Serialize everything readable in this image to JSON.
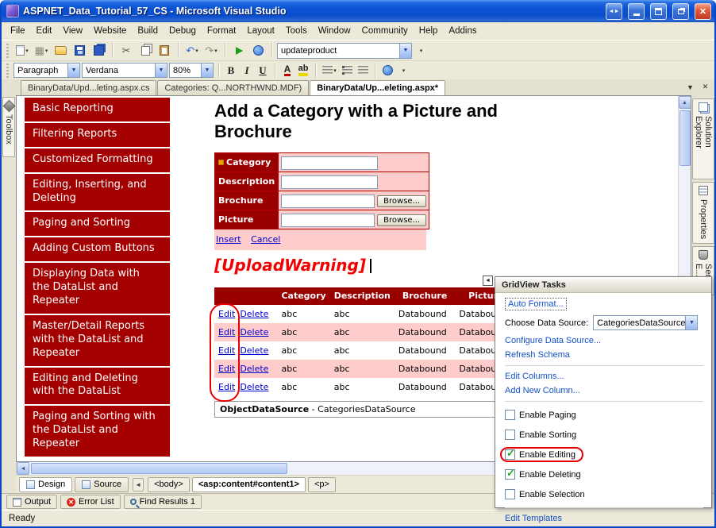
{
  "window": {
    "title": "ASPNET_Data_Tutorial_57_CS - Microsoft Visual Studio",
    "status": "Ready"
  },
  "menu": [
    "File",
    "Edit",
    "View",
    "Website",
    "Build",
    "Debug",
    "Format",
    "Layout",
    "Tools",
    "Window",
    "Community",
    "Help",
    "Addins"
  ],
  "standard_toolbar": {
    "combo_value": "updateproduct"
  },
  "format_toolbar": {
    "block_format": "Paragraph",
    "font_name": "Verdana",
    "font_size": "80%",
    "bold": "B",
    "italic": "I",
    "underline": "U"
  },
  "document_tabs": [
    "BinaryData/Upd...leting.aspx.cs",
    "Categories: Q...NORTHWND.MDF)",
    "BinaryData/Up...eleting.aspx*"
  ],
  "toolbox_tab": "Toolbox",
  "tutorial_nav": [
    "Basic Reporting",
    "Filtering Reports",
    "Customized Formatting",
    "Editing, Inserting, and Deleting",
    "Paging and Sorting",
    "Adding Custom Buttons",
    "Displaying Data with the DataList and Repeater",
    "Master/Detail Reports with the DataList and Repeater",
    "Editing and Deleting with the DataList",
    "Paging and Sorting with the DataList and Repeater"
  ],
  "page": {
    "heading": "Add a Category with a Picture and Brochure",
    "form_labels": [
      "Category",
      "Description",
      "Brochure",
      "Picture"
    ],
    "browse_button": "Browse...",
    "insert_link": "Insert",
    "cancel_link": "Cancel",
    "upload_warning": "[UploadWarning]",
    "grid": {
      "headers": [
        "Category",
        "Description",
        "Brochure",
        "Picture"
      ],
      "rows": [
        [
          "Edit",
          "Delete",
          "abc",
          "abc",
          "Databound",
          "Databound"
        ],
        [
          "Edit",
          "Delete",
          "abc",
          "abc",
          "Databound",
          "Databound"
        ],
        [
          "Edit",
          "Delete",
          "abc",
          "abc",
          "Databound",
          "Databound"
        ],
        [
          "Edit",
          "Delete",
          "abc",
          "abc",
          "Databound",
          "Databound"
        ],
        [
          "Edit",
          "Delete",
          "abc",
          "abc",
          "Databound",
          "Databound"
        ]
      ]
    },
    "datasource_bold": "ObjectDataSource",
    "datasource_rest": " - CategoriesDataSource"
  },
  "tasks_panel": {
    "title": "GridView Tasks",
    "auto_format": "Auto Format...",
    "choose_data_source_label": "Choose Data Source:",
    "choose_data_source_value": "CategoriesDataSource",
    "configure": "Configure Data Source...",
    "refresh": "Refresh Schema",
    "edit_columns": "Edit Columns...",
    "add_column": "Add New Column...",
    "checkboxes": [
      {
        "label": "Enable Paging",
        "mark": ""
      },
      {
        "label": "Enable Sorting",
        "mark": ""
      },
      {
        "label": "Enable Editing",
        "mark": "✓"
      },
      {
        "label": "Enable Deleting",
        "mark": "✓"
      },
      {
        "label": "Enable Selection",
        "mark": ""
      }
    ],
    "edit_templates": "Edit Templates"
  },
  "right_tabs": [
    "Solution Explorer",
    "Properties",
    "Server E..."
  ],
  "view_bar": {
    "design": "Design",
    "source": "Source",
    "breadcrumbs": [
      "<body>",
      "<asp:content#content1>",
      "<p>"
    ]
  },
  "tool_tabs": [
    "Output",
    "Error List",
    "Find Results 1"
  ]
}
